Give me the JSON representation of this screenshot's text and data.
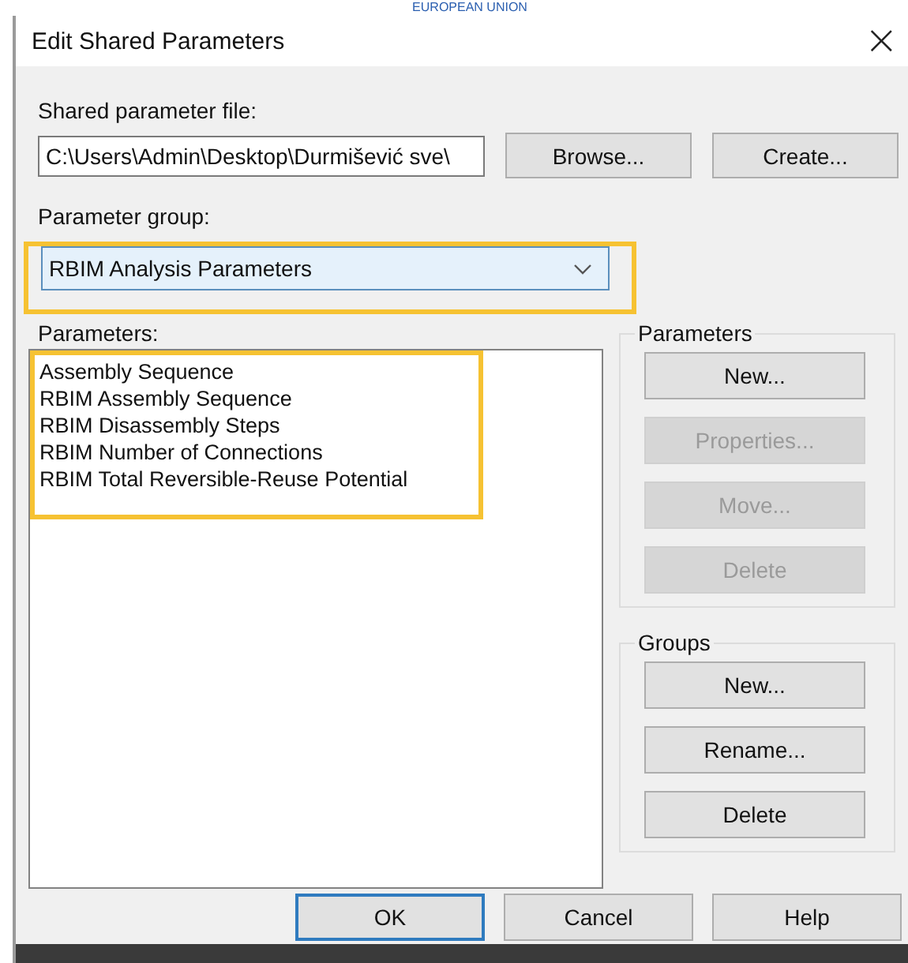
{
  "header_fragment": "EUROPEAN UNION",
  "window": {
    "title": "Edit Shared Parameters",
    "close": "×"
  },
  "file": {
    "label": "Shared parameter file:",
    "value": "C:\\Users\\Admin\\Desktop\\Durmišević sve\\",
    "buttons": [
      {
        "label": "Browse...",
        "disabled": false
      },
      {
        "label": "Create...",
        "disabled": false
      }
    ]
  },
  "group": {
    "label": "Parameter group:",
    "value": "RBIM Analysis Parameters",
    "highlighted": true
  },
  "parameters": {
    "label": "Parameters:",
    "highlighted": true,
    "items": [
      "Assembly Sequence",
      "RBIM Assembly Sequence",
      "RBIM Disassembly Steps",
      "RBIM Number of Connections",
      "RBIM Total Reversible-Reuse Potential"
    ]
  },
  "panels": [
    {
      "title": "Parameters",
      "buttons": [
        {
          "label": "New...",
          "disabled": false
        },
        {
          "label": "Properties...",
          "disabled": true
        },
        {
          "label": "Move...",
          "disabled": true
        },
        {
          "label": "Delete",
          "disabled": true
        }
      ]
    },
    {
      "title": "Groups",
      "buttons": [
        {
          "label": "New...",
          "disabled": false
        },
        {
          "label": "Rename...",
          "disabled": false
        },
        {
          "label": "Delete",
          "disabled": false
        }
      ]
    }
  ],
  "footer": [
    {
      "label": "OK",
      "default": true
    },
    {
      "label": "Cancel",
      "default": false
    },
    {
      "label": "Help",
      "default": false
    }
  ]
}
